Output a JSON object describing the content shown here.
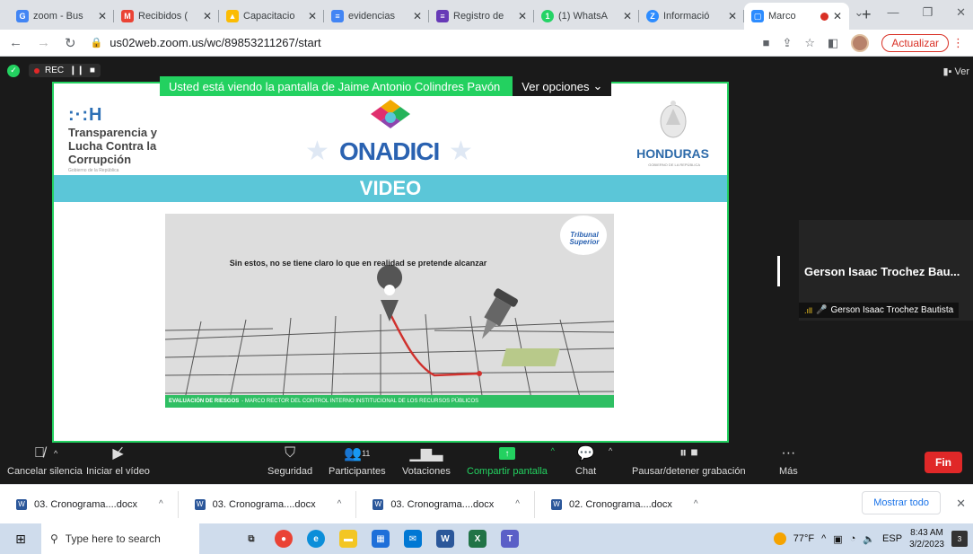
{
  "browser": {
    "tabs": [
      {
        "title": "zoom - Bus",
        "favicon": "google-icon",
        "color": "#4285f4",
        "glyph": "G"
      },
      {
        "title": "Recibidos (",
        "favicon": "gmail-icon",
        "color": "#ea4335",
        "glyph": "M"
      },
      {
        "title": "Capacitacio",
        "favicon": "drive-icon",
        "color": "#fbbc04",
        "glyph": "▲"
      },
      {
        "title": "evidencias",
        "favicon": "docs-icon",
        "color": "#4285f4",
        "glyph": "≡"
      },
      {
        "title": "Registro de",
        "favicon": "forms-icon",
        "color": "#673ab7",
        "glyph": "≡"
      },
      {
        "title": "(1) WhatsA",
        "favicon": "whatsapp-icon",
        "color": "#25d366",
        "glyph": "1"
      },
      {
        "title": "Informació",
        "favicon": "zoom-info-icon",
        "color": "#2d8cff",
        "glyph": "Z"
      },
      {
        "title": "Marco",
        "favicon": "zoom-icon",
        "color": "#2d8cff",
        "glyph": "▢"
      }
    ],
    "new_tab": "+",
    "url": "us02web.zoom.us/wc/89853211267/start",
    "update_label": "Actualizar"
  },
  "meeting": {
    "rec_label": "REC",
    "view_label": "Ver",
    "banner_text": "Usted está viendo la pantalla de Jaime Antonio Colindres Pavón",
    "view_options": "Ver opciones",
    "slide": {
      "left_logo_mark": ":·:H",
      "left_logo_text": [
        "Transparencia y",
        "Lucha Contra la",
        "Corrupción"
      ],
      "left_logo_small": "Gobierno de la República",
      "center_logo": "ONADICI",
      "right_logo": "HONDURAS",
      "right_logo_sub": "GOBIERNO DE LA REPÚBLICA",
      "video_title": "VIDEO",
      "inner_caption": "Sin estos, no se tiene claro lo que en realidad se pretende alcanzar",
      "tribunal_label": "Tribunal Superior",
      "footer_bold": "EVALUACIÓN DE RIESGOS",
      "footer_text": "- MARCO RECTOR DEL CONTROL INTERNO INSTITUCIONAL DE LOS RECURSOS PÚBLICOS"
    },
    "participant_name_short": "Gerson Isaac Trochez Bau...",
    "participant_name_full": "Gerson Isaac Trochez Bautista"
  },
  "toolbar": {
    "mute_label": "Cancelar silencia",
    "video_label": "Iniciar el vídeo",
    "security_label": "Seguridad",
    "participants_label": "Participantes",
    "participants_count": "11",
    "polls_label": "Votaciones",
    "share_label": "Compartir pantalla",
    "chat_label": "Chat",
    "record_label": "Pausar/detener grabación",
    "more_label": "Más",
    "end_label": "Fin"
  },
  "downloads": {
    "items": [
      "03. Cronograma....docx",
      "03. Cronograma....docx",
      "03. Cronograma....docx",
      "02. Cronograma....docx"
    ],
    "show_all": "Mostrar todo"
  },
  "taskbar": {
    "search_placeholder": "Type here to search",
    "weather": "77°F",
    "language": "ESP",
    "time": "8:43 AM",
    "date": "3/2/2023",
    "notifications": "3"
  }
}
